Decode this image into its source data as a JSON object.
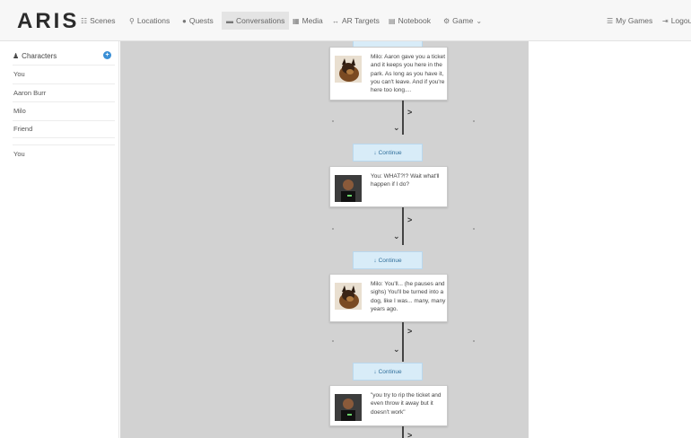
{
  "header": {
    "logo": "ARIS",
    "nav": [
      {
        "icon": "scenes-icon",
        "glyph": "☷",
        "label": "Scenes"
      },
      {
        "icon": "location-pin-icon",
        "glyph": "⚲",
        "label": "Locations"
      },
      {
        "icon": "quests-icon",
        "glyph": "●",
        "label": "Quests"
      },
      {
        "icon": "conversations-icon",
        "glyph": "▬",
        "label": "Conversations"
      },
      {
        "icon": "media-icon",
        "glyph": "▦",
        "label": "Media"
      },
      {
        "icon": "ar-targets-icon",
        "glyph": "↔",
        "label": "AR Targets"
      },
      {
        "icon": "notebook-icon",
        "glyph": "▤",
        "label": "Notebook"
      },
      {
        "icon": "game-icon",
        "glyph": "⚙",
        "label": "Game"
      }
    ],
    "my_games": "My Games",
    "logout": "Logou"
  },
  "sidebar": {
    "title": "Characters",
    "items": [
      "You",
      "Aaron Burr",
      "Milo",
      "Friend"
    ],
    "extra": [
      "You"
    ]
  },
  "conversation": {
    "cards": [
      {
        "speaker": "dog",
        "text": "Milo: Aaron gave you a ticket and it keeps you here in the park. As long as you have it, you can't leave. And if you're here too long...."
      },
      {
        "speaker": "you",
        "text": "You: WHAT?!? Wait what'll happen if I do?"
      },
      {
        "speaker": "dog",
        "text": "Milo: You'll... (he pauses and sighs) You'll be turned into a dog, like I was... many, many years ago."
      },
      {
        "speaker": "you",
        "text": "\"you try to rip the ticket and even throw it away but it doesn't work\""
      }
    ],
    "continue_label": "Continue"
  },
  "colors": {
    "canvas": "#d2d2d2",
    "continue_bg": "#d8ecf8",
    "accent": "#3a8fd6"
  }
}
